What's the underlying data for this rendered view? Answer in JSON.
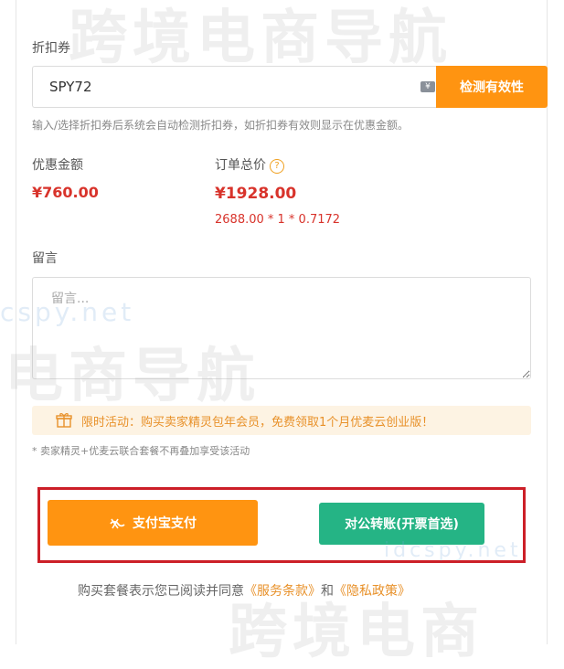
{
  "coupon": {
    "label": "折扣券",
    "value": "SPY72",
    "clear_glyph": "¥",
    "check_button": "检测有效性",
    "hint": "输入/选择折扣券后系统会自动检测折扣券，如折扣券有效则显示在优惠金额。"
  },
  "summary": {
    "discount_label": "优惠金额",
    "discount_value": "¥760.00",
    "total_label": "订单总价",
    "help_glyph": "?",
    "total_value": "¥1928.00",
    "formula": "2688.00 * 1 * 0.7172"
  },
  "message": {
    "label": "留言",
    "placeholder": "留言..."
  },
  "promo": {
    "text": "限时活动：购买卖家精灵包年会员，免费领取1个月优麦云创业版！",
    "note": "* 卖家精灵+优麦云联合套餐不再叠加享受该活动"
  },
  "payment": {
    "alipay_button": "支付宝支付",
    "bank_button": "对公转账(开票首选)"
  },
  "agreement": {
    "prefix": "购买套餐表示您已阅读并同意",
    "terms": "《服务条款》",
    "and": "和",
    "privacy": "《隐私政策》"
  },
  "watermarks": {
    "main": "跨境电商导航",
    "secondary": "电商导航",
    "url": "cspy.net",
    "url2": "idcspy.net",
    "bottom": "跨境电商"
  },
  "colors": {
    "accent": "#ff9411",
    "green": "#25b485",
    "price_red": "#d8332b",
    "highlight_red": "#cc1f28"
  }
}
